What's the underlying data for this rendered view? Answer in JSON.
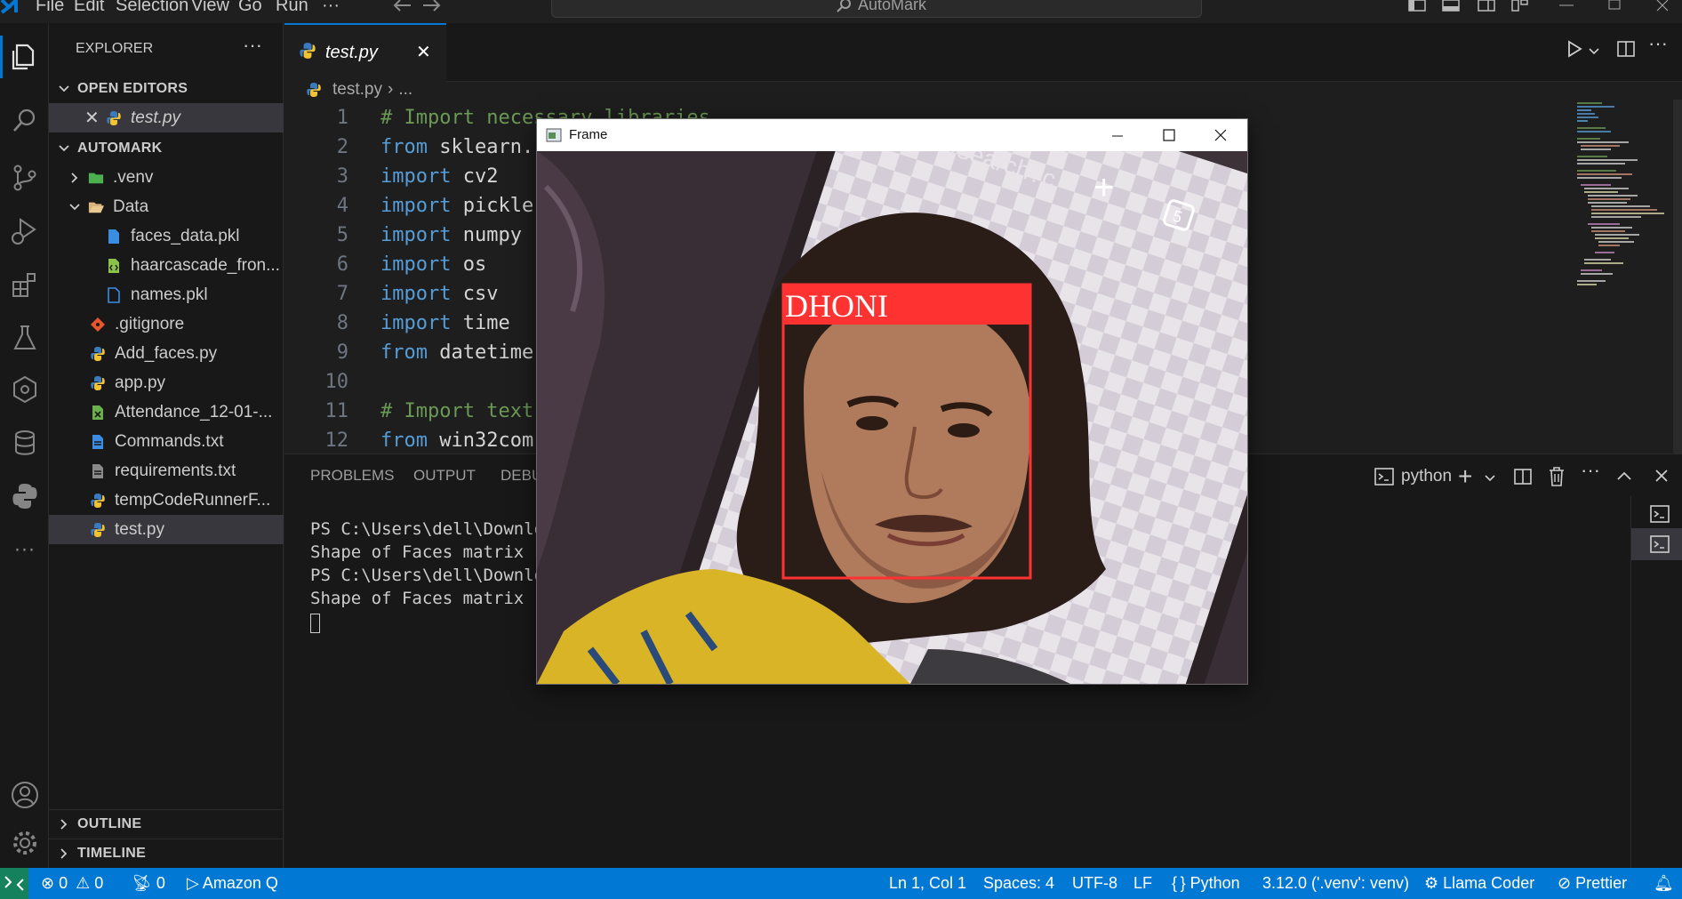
{
  "titlebar": {
    "menu": [
      "File",
      "Edit",
      "Selection",
      "View",
      "Go",
      "Run",
      "···"
    ],
    "search_text": "AutoMark"
  },
  "sidebar": {
    "title": "EXPLORER",
    "open_editors_label": "OPEN EDITORS",
    "open_editor_file": "test.py",
    "project_label": "AUTOMARK",
    "tree": [
      {
        "label": ".venv",
        "icon": "venv-folder-icon"
      },
      {
        "label": "Data",
        "icon": "folder-open-icon"
      },
      {
        "label": "faces_data.pkl",
        "icon": "file-icon"
      },
      {
        "label": "haarcascade_fron...",
        "icon": "xml-file-icon"
      },
      {
        "label": "names.pkl",
        "icon": "file-icon"
      },
      {
        "label": ".gitignore",
        "icon": "git-icon"
      },
      {
        "label": "Add_faces.py",
        "icon": "python-icon"
      },
      {
        "label": "app.py",
        "icon": "python-icon"
      },
      {
        "label": "Attendance_12-01-...",
        "icon": "csv-icon"
      },
      {
        "label": "Commands.txt",
        "icon": "text-file-icon"
      },
      {
        "label": "requirements.txt",
        "icon": "text-file-icon"
      },
      {
        "label": "tempCodeRunnerF...",
        "icon": "python-icon"
      },
      {
        "label": "test.py",
        "icon": "python-icon"
      }
    ],
    "outline_label": "OUTLINE",
    "timeline_label": "TIMELINE"
  },
  "editor": {
    "tab_label": "test.py",
    "breadcrumb_file": "test.py",
    "breadcrumb_rest": "...",
    "lines": [
      {
        "n": "1",
        "kw": "",
        "rest": "",
        "comment": "# Import necessary libraries"
      },
      {
        "n": "2",
        "kw": "from",
        "rest": " sklearn.",
        "comment": ""
      },
      {
        "n": "3",
        "kw": "import",
        "rest": " cv2",
        "comment": ""
      },
      {
        "n": "4",
        "kw": "import",
        "rest": " pickle",
        "comment": ""
      },
      {
        "n": "5",
        "kw": "import",
        "rest": " numpy",
        "comment": ""
      },
      {
        "n": "6",
        "kw": "import",
        "rest": " os",
        "comment": ""
      },
      {
        "n": "7",
        "kw": "import",
        "rest": " csv",
        "comment": ""
      },
      {
        "n": "8",
        "kw": "import",
        "rest": " time",
        "comment": ""
      },
      {
        "n": "9",
        "kw": "from",
        "rest": " datetime",
        "comment": ""
      },
      {
        "n": "10",
        "kw": "",
        "rest": "",
        "comment": ""
      },
      {
        "n": "11",
        "kw": "",
        "rest": "",
        "comment": "# Import text"
      },
      {
        "n": "12",
        "kw": "from",
        "rest": " win32com",
        "comment": ""
      }
    ]
  },
  "panel": {
    "tabs": [
      "PROBLEMS",
      "OUTPUT",
      "DEBU"
    ],
    "terminal_name": "python",
    "terminal_lines": [
      "PS C:\\Users\\dell\\Downlo",
      "Shape of Faces matrix -",
      "PS C:\\Users\\dell\\Downlo",
      "Shape of Faces matrix -"
    ]
  },
  "frame_window": {
    "title": "Frame",
    "detection_label": "DHONI",
    "overlay_text": "/search?c",
    "box_color": "#ff3232"
  },
  "statusbar": {
    "errors": "0",
    "warnings": "0",
    "ports": "0",
    "amazon_q": "Amazon Q",
    "position": "Ln 1, Col 1",
    "spaces": "Spaces: 4",
    "encoding": "UTF-8",
    "eol": "LF",
    "language": "Python",
    "interpreter": "3.12.0 ('.venv': venv)",
    "llama": "Llama Coder",
    "prettier": "Prettier"
  }
}
